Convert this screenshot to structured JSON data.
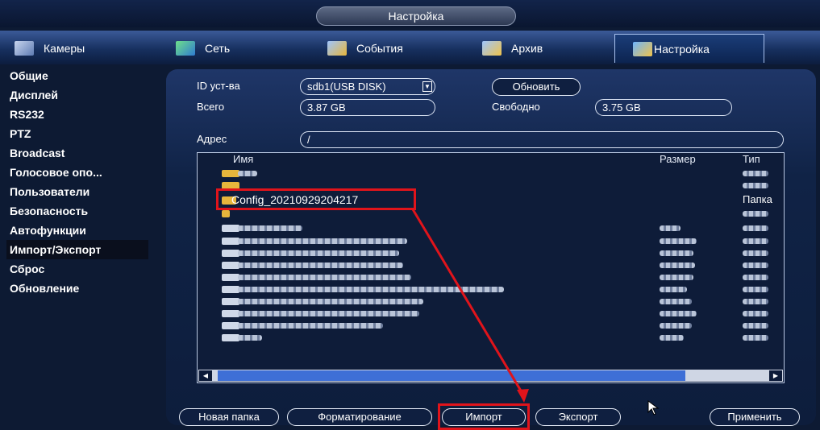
{
  "window": {
    "title": "Настройка"
  },
  "tabs": [
    {
      "label": "Камеры",
      "icon": "camera-icon"
    },
    {
      "label": "Сеть",
      "icon": "network-icon"
    },
    {
      "label": "События",
      "icon": "events-icon"
    },
    {
      "label": "Архив",
      "icon": "archive-icon"
    },
    {
      "label": "Настройка",
      "icon": "settings-icon",
      "active": true
    }
  ],
  "sidebar": {
    "items": [
      {
        "label": "Общие"
      },
      {
        "label": "Дисплей"
      },
      {
        "label": "RS232"
      },
      {
        "label": "PTZ"
      },
      {
        "label": "Broadcast"
      },
      {
        "label": "Голосовое опо..."
      },
      {
        "label": "Пользователи"
      },
      {
        "label": "Безопасность"
      },
      {
        "label": "Автофункции"
      },
      {
        "label": "Импорт/Экспорт",
        "active": true
      },
      {
        "label": "Сброс"
      },
      {
        "label": "Обновление"
      }
    ]
  },
  "device": {
    "id_label": "ID уст-ва",
    "id_value": "sdb1(USB DISK)",
    "refresh_label": "Обновить",
    "total_label": "Всего",
    "total_value": "3.87 GB",
    "free_label": "Свободно",
    "free_value": "3.75 GB"
  },
  "address": {
    "label": "Адрес",
    "value": "/"
  },
  "files": {
    "headers": {
      "name": "Имя",
      "size": "Размер",
      "type": "Тип"
    },
    "highlighted": {
      "name": "Config_20210929204217",
      "type": "Папка"
    }
  },
  "buttons": {
    "new_folder": "Новая папка",
    "format": "Форматирование",
    "import": "Импорт",
    "export": "Экспорт",
    "apply": "Применить"
  },
  "colors": {
    "highlight": "#e0141b",
    "accent": "#3e6fd6",
    "folder": "#e7b63c"
  }
}
